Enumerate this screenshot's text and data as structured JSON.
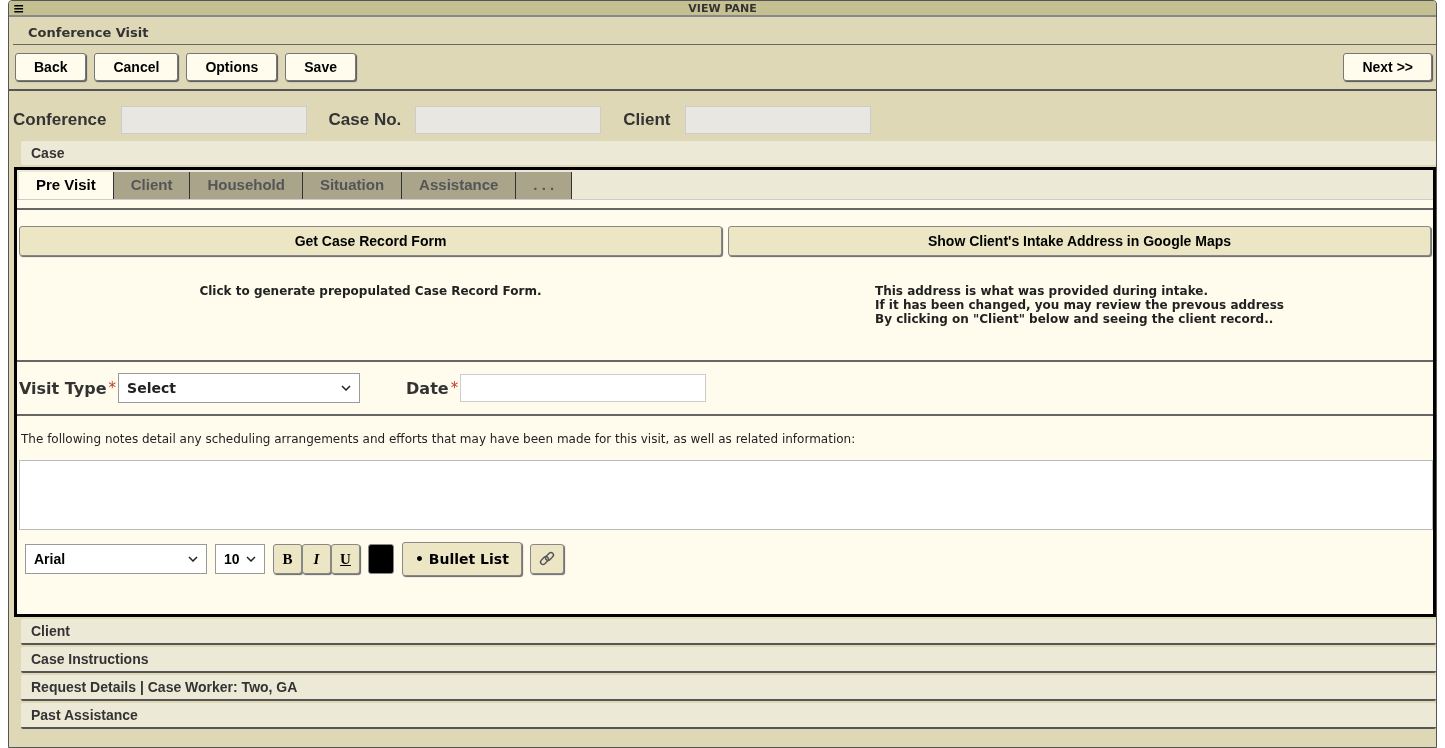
{
  "window": {
    "menu_glyph": "≡",
    "title": "VIEW PANE"
  },
  "section_title": "Conference Visit",
  "toolbar": {
    "left": [
      "Back",
      "Cancel",
      "Options",
      "Save"
    ],
    "right": [
      "Next >>"
    ]
  },
  "fields": [
    {
      "label": "Conference"
    },
    {
      "label": "Case No."
    },
    {
      "label": "Client"
    }
  ],
  "case_header": "Case",
  "tabs": [
    {
      "label": "Pre Visit",
      "selected": true
    },
    {
      "label": "Client",
      "selected": false
    },
    {
      "label": "Household",
      "selected": false
    },
    {
      "label": "Situation",
      "selected": false
    },
    {
      "label": "Assistance",
      "selected": false
    },
    {
      "label": ". . .",
      "selected": false
    }
  ],
  "actions": [
    {
      "label": "Get Case Record Form",
      "note": [
        "Click to generate prepopulated Case Record Form."
      ]
    },
    {
      "label": "Show Client's Intake Address in Google Maps",
      "note": [
        "This address is what was provided during intake.",
        "If it has been changed, you may review the prevous address",
        "By clicking on \"Client\" below and seeing the client record.."
      ]
    }
  ],
  "visit_type": {
    "label": "Visit Type",
    "required_mark": "*",
    "value": "Select"
  },
  "date": {
    "label": "Date",
    "required_mark": "*"
  },
  "notes_intro": "The following notes detail any scheduling arrangements and efforts that may have been made for this visit, as well as related information:",
  "editor": {
    "font": "Arial",
    "size": "10",
    "bold": "B",
    "italic": "I",
    "underline": "U",
    "color": "#000000",
    "bullet": "• Bullet List"
  },
  "accordion": [
    "Client",
    "Case Instructions",
    "Request Details | Case Worker: Two, GA",
    "Past Assistance"
  ]
}
